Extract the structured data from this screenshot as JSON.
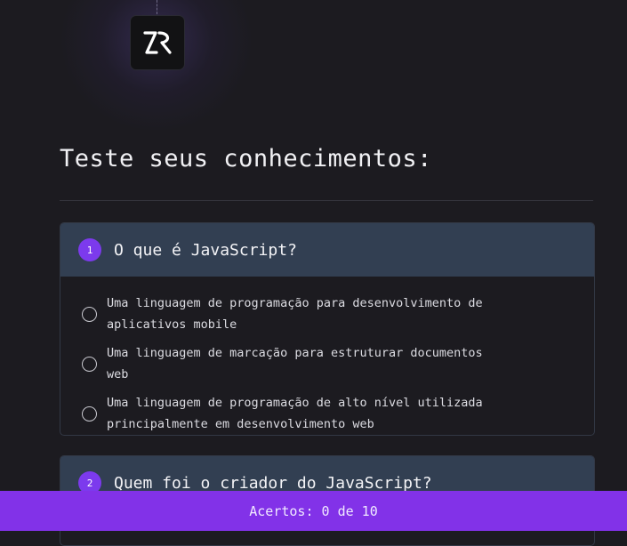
{
  "page_title": "Teste seus conhecimentos:",
  "logo_icon": "rocketseat-logo-icon",
  "questions": [
    {
      "number": "1",
      "question": "O que é JavaScript?",
      "options": [
        "Uma linguagem de programação para desenvolvimento de aplicativos mobile",
        "Uma linguagem de marcação para estruturar documentos web",
        "Uma linguagem de programação de alto nível utilizada principalmente em desenvolvimento web"
      ]
    },
    {
      "number": "2",
      "question": "Quem foi o criador do JavaScript?",
      "options": []
    }
  ],
  "footer": {
    "score_text": "Acertos: 0 de 10"
  },
  "colors": {
    "background": "#1c1b20",
    "card_header": "#323f52",
    "accent": "#7c3aed",
    "footer": "#8232e8"
  }
}
